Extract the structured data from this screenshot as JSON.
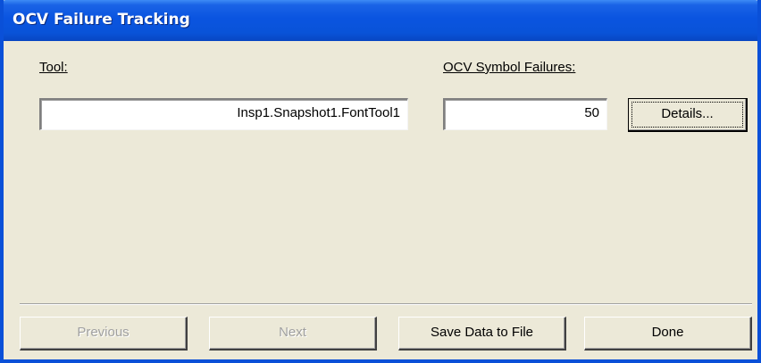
{
  "window": {
    "title": "OCV Failure Tracking"
  },
  "tool": {
    "label": "Tool:",
    "value": "Insp1.Snapshot1.FontTool1"
  },
  "failures": {
    "label": "OCV Symbol Failures:",
    "value": "50"
  },
  "buttons": {
    "details": "Details...",
    "previous": "Previous",
    "next": "Next",
    "save": "Save Data to File",
    "done": "Done"
  },
  "colors": {
    "titlebar": "#0A54E0",
    "dialog_background": "#ECE9D8",
    "disabled_text": "#A0A0A0"
  }
}
